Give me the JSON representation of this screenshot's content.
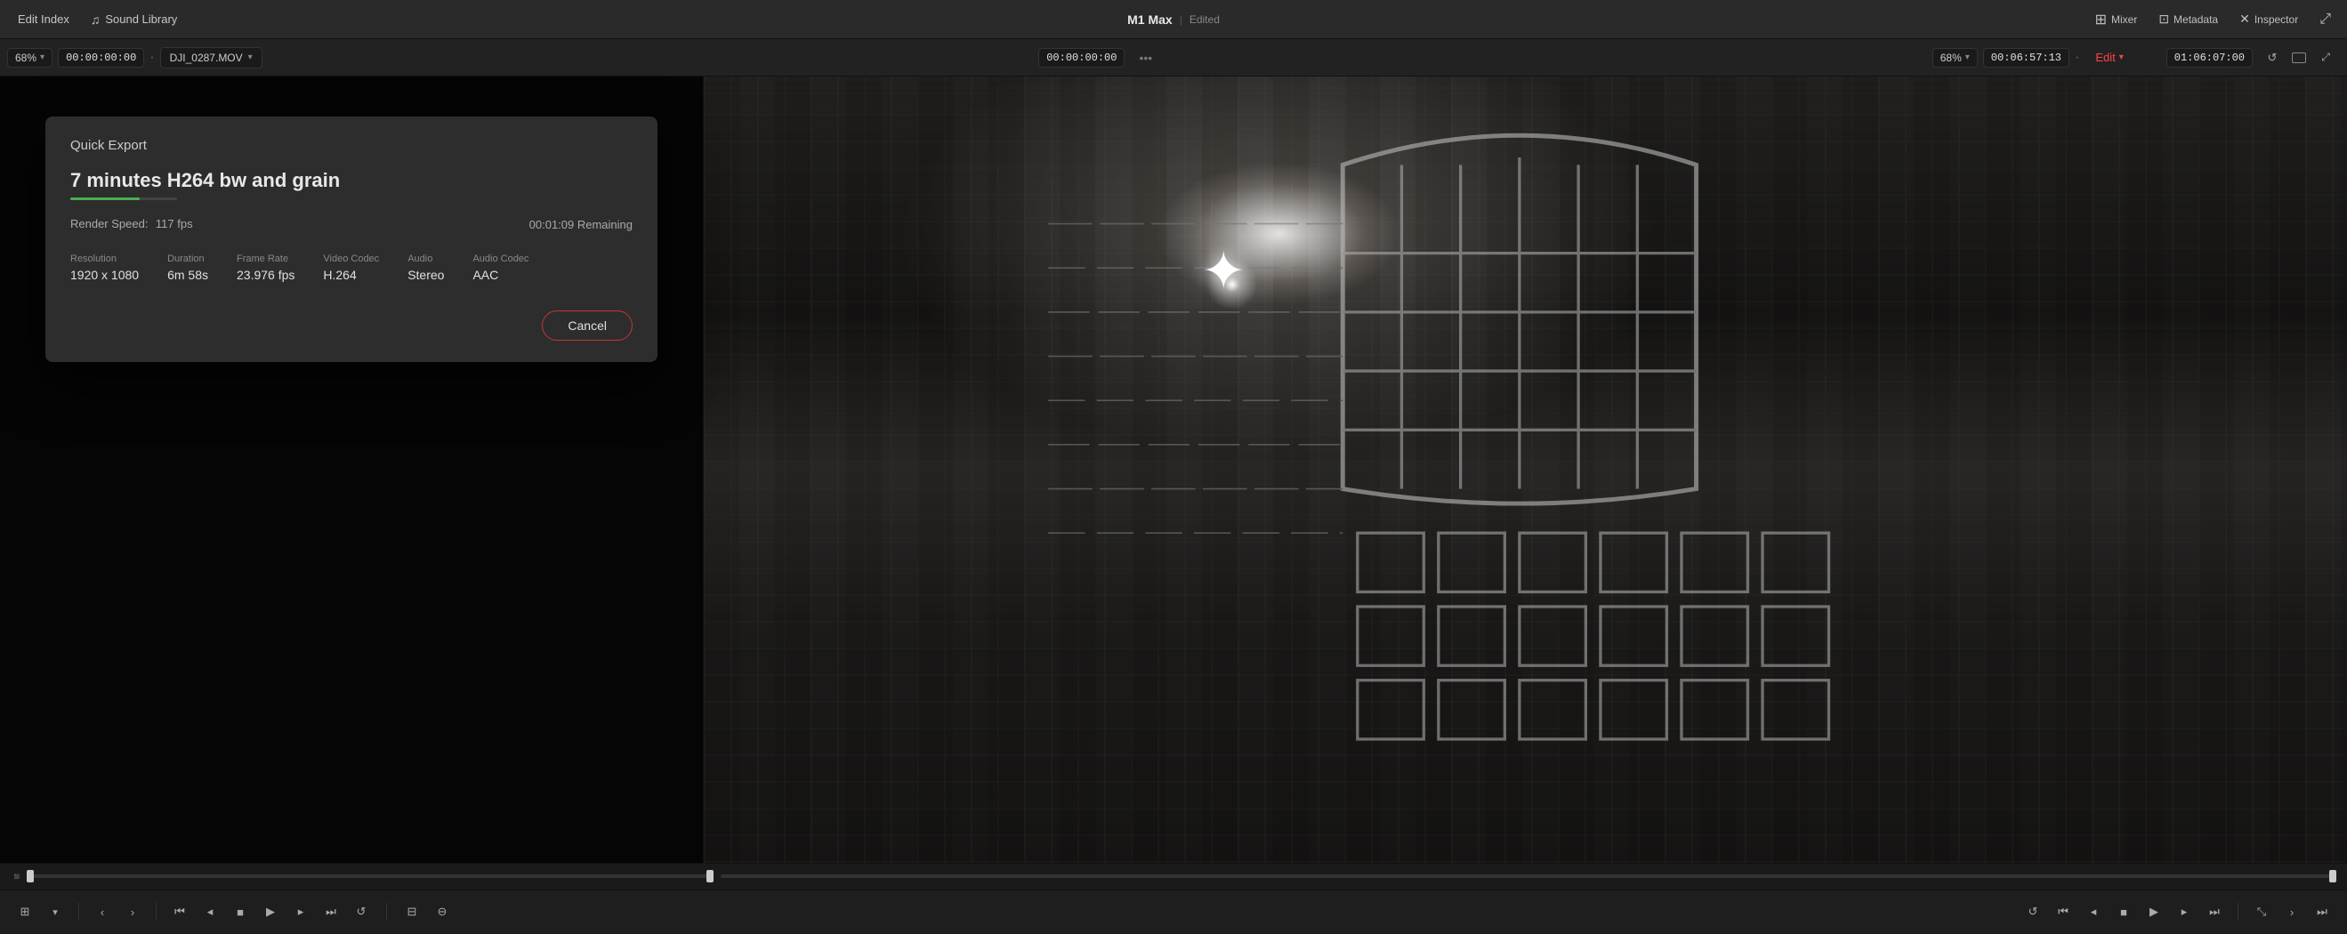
{
  "app": {
    "title": "M1 Max",
    "subtitle": "Edited"
  },
  "toolbar": {
    "edit_index_label": "Edit Index",
    "sound_library_label": "Sound Library",
    "mixer_label": "Mixer",
    "metadata_label": "Metadata",
    "inspector_label": "Inspector"
  },
  "secondary_toolbar": {
    "left_zoom": "68%",
    "left_timecode": "00:00:00:00",
    "filename": "DJI_0287.MOV",
    "center_timecode": "00:00:00:00",
    "right_zoom": "68%",
    "right_timecode": "00:06:57:13",
    "edit_label": "Edit",
    "far_right_timecode": "01:06:07:00"
  },
  "quick_export": {
    "dialog_title": "Quick Export",
    "export_name": "7 minutes H264 bw and grain",
    "render_speed_label": "Render Speed:",
    "render_speed_value": "117 fps",
    "remaining": "00:01:09 Remaining",
    "specs": {
      "resolution_label": "Resolution",
      "resolution_value": "1920 x 1080",
      "duration_label": "Duration",
      "duration_value": "6m 58s",
      "frame_rate_label": "Frame Rate",
      "frame_rate_value": "23.976 fps",
      "video_codec_label": "Video Codec",
      "video_codec_value": "H.264",
      "audio_label": "Audio",
      "audio_value": "Stereo",
      "audio_codec_label": "Audio Codec",
      "audio_codec_value": "AAC"
    },
    "cancel_label": "Cancel",
    "progress_percent": 65
  },
  "controls": {
    "back_label": "‹",
    "forward_label": "›",
    "prev_clip": "⏮",
    "prev_frame": "◂",
    "play": "▶",
    "next_frame": "▸",
    "next_clip": "⏭",
    "loop": "↺"
  },
  "icons": {
    "music_note": "♫",
    "chevron_down": "▾",
    "chevron_right": "▸",
    "dots": "•••",
    "grid": "⊞",
    "mixer": "⊟",
    "tag": "⊡"
  }
}
